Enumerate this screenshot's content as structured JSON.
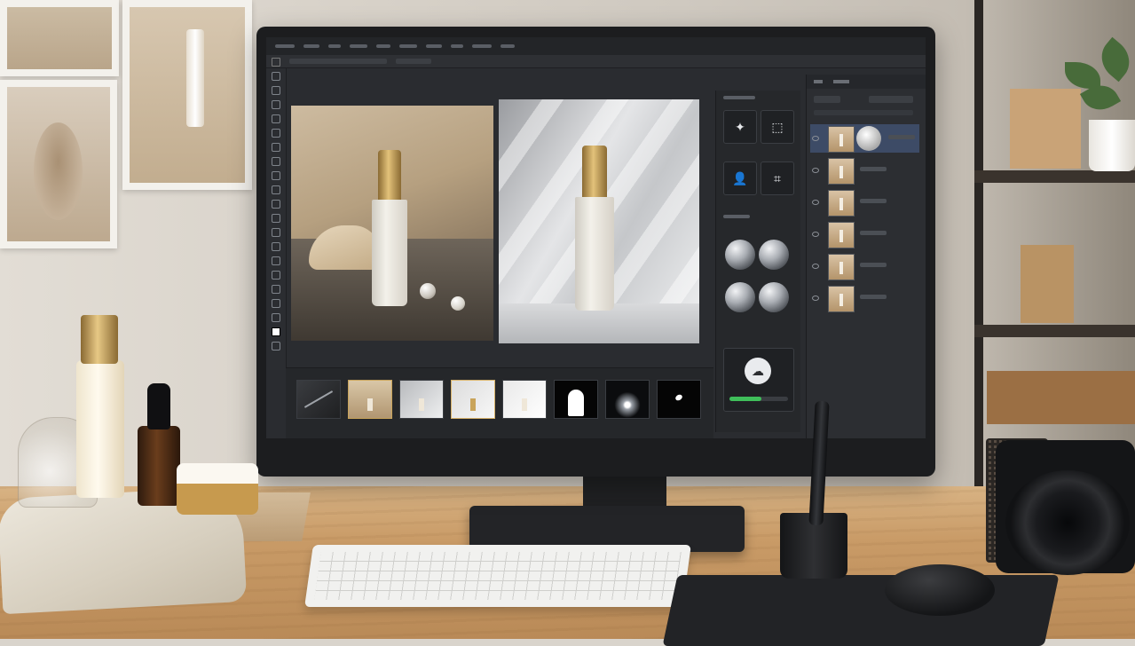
{
  "scene": {
    "description_tags": [
      "desk",
      "monitor",
      "photo-editing-app",
      "cosmetics",
      "keyboard",
      "camera"
    ]
  },
  "app": {
    "menu_items": [
      "",
      "",
      "",
      "",
      "",
      "",
      "",
      "",
      "",
      "",
      "",
      "",
      "",
      ""
    ],
    "panels": {
      "tools": {
        "tool_icons": [
          "magic-wand-icon",
          "marquee-icon",
          "person-select-icon",
          "crop-icon"
        ]
      },
      "upload": {
        "icon": "cloud-upload-icon",
        "progress_fraction": 0.55
      }
    },
    "layers": {
      "rows": 6,
      "active_index": 0
    }
  },
  "colors": {
    "accent_green": "#3fbf5a",
    "active_layer": "#3d4b66",
    "gold": "#d8b36a"
  }
}
